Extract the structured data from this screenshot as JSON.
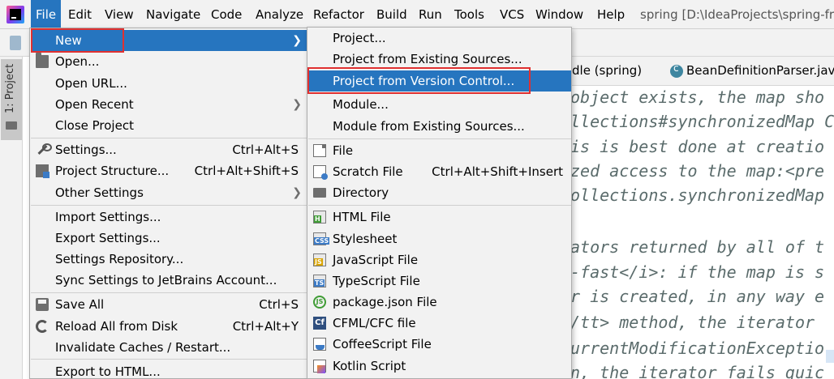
{
  "window_title": "spring [D:\\IdeaProjects\\spring-fra",
  "menubar": {
    "items": [
      "File",
      "Edit",
      "View",
      "Navigate",
      "Code",
      "Analyze",
      "Refactor",
      "Build",
      "Run",
      "Tools",
      "VCS",
      "Window",
      "Help"
    ],
    "active": "File"
  },
  "sidebar": {
    "project_tab": "1: Project"
  },
  "editor": {
    "tabs": [
      "dle (spring)",
      "BeanDefinitionParser.java"
    ],
    "lines": [
      "object exists, the map sho",
      "llections#synchronizedMap C",
      "is is best done at creatio",
      "zed access to the map:<pre",
      "ollections.synchronizedMap",
      "",
      "ators returned by all of t",
      "-fast</i>: if the map is s",
      "r is created, in any way e",
      "/tt> method, the iterator",
      "urrentModificationExceptio",
      "n, the iterator fails quic"
    ]
  },
  "file_menu": {
    "items": [
      {
        "label": "New",
        "shortcut": "",
        "submenu": true,
        "highlighted": true,
        "icon": ""
      },
      {
        "label": "Open...",
        "shortcut": "",
        "submenu": false,
        "icon": "folder-open-icon"
      },
      {
        "label": "Open URL...",
        "shortcut": "",
        "submenu": false,
        "icon": ""
      },
      {
        "label": "Open Recent",
        "shortcut": "",
        "submenu": true,
        "icon": ""
      },
      {
        "label": "Close Project",
        "shortcut": "",
        "submenu": false,
        "icon": ""
      },
      {
        "label": "Settings...",
        "shortcut": "Ctrl+Alt+S",
        "submenu": false,
        "icon": "wrench-icon"
      },
      {
        "label": "Project Structure...",
        "shortcut": "Ctrl+Alt+Shift+S",
        "submenu": false,
        "icon": "project-structure-icon"
      },
      {
        "label": "Other Settings",
        "shortcut": "",
        "submenu": true,
        "icon": ""
      },
      {
        "label": "Import Settings...",
        "shortcut": "",
        "submenu": false,
        "icon": ""
      },
      {
        "label": "Export Settings...",
        "shortcut": "",
        "submenu": false,
        "icon": ""
      },
      {
        "label": "Settings Repository...",
        "shortcut": "",
        "submenu": false,
        "icon": ""
      },
      {
        "label": "Sync Settings to JetBrains Account...",
        "shortcut": "",
        "submenu": false,
        "icon": ""
      },
      {
        "label": "Save All",
        "shortcut": "Ctrl+S",
        "submenu": false,
        "icon": "save-icon"
      },
      {
        "label": "Reload All from Disk",
        "shortcut": "Ctrl+Alt+Y",
        "submenu": false,
        "icon": "reload-icon"
      },
      {
        "label": "Invalidate Caches / Restart...",
        "shortcut": "",
        "submenu": false,
        "icon": ""
      },
      {
        "label": "Export to HTML...",
        "shortcut": "",
        "submenu": false,
        "icon": ""
      }
    ]
  },
  "new_menu": {
    "items": [
      {
        "label": "Project...",
        "shortcut": "",
        "icon": ""
      },
      {
        "label": "Project from Existing Sources...",
        "shortcut": "",
        "icon": ""
      },
      {
        "label": "Project from Version Control...",
        "shortcut": "",
        "icon": "",
        "highlighted": true
      },
      {
        "label": "Module...",
        "shortcut": "",
        "icon": ""
      },
      {
        "label": "Module from Existing Sources...",
        "shortcut": "",
        "icon": ""
      },
      {
        "label": "File",
        "shortcut": "",
        "icon": "file-icon"
      },
      {
        "label": "Scratch File",
        "shortcut": "Ctrl+Alt+Shift+Insert",
        "icon": "scratch-file-icon"
      },
      {
        "label": "Directory",
        "shortcut": "",
        "icon": "folder-icon"
      },
      {
        "label": "HTML File",
        "shortcut": "",
        "icon": "html-file-icon",
        "badge": "H"
      },
      {
        "label": "Stylesheet",
        "shortcut": "",
        "icon": "css-file-icon",
        "badge": "CSS"
      },
      {
        "label": "JavaScript File",
        "shortcut": "",
        "icon": "javascript-file-icon",
        "badge": "JS"
      },
      {
        "label": "TypeScript File",
        "shortcut": "",
        "icon": "typescript-file-icon",
        "badge": "TS"
      },
      {
        "label": "package.json File",
        "shortcut": "",
        "icon": "nodejs-icon",
        "badge": "JS"
      },
      {
        "label": "CFML/CFC file",
        "shortcut": "",
        "icon": "cfml-icon",
        "badge": "Cf"
      },
      {
        "label": "CoffeeScript File",
        "shortcut": "",
        "icon": "coffeescript-icon"
      },
      {
        "label": "Kotlin Script",
        "shortcut": "",
        "icon": "kotlin-icon"
      }
    ]
  },
  "colors": {
    "highlight": "#2675bf",
    "menu_bg": "#f2f2f2",
    "red_box": "#e03030"
  }
}
